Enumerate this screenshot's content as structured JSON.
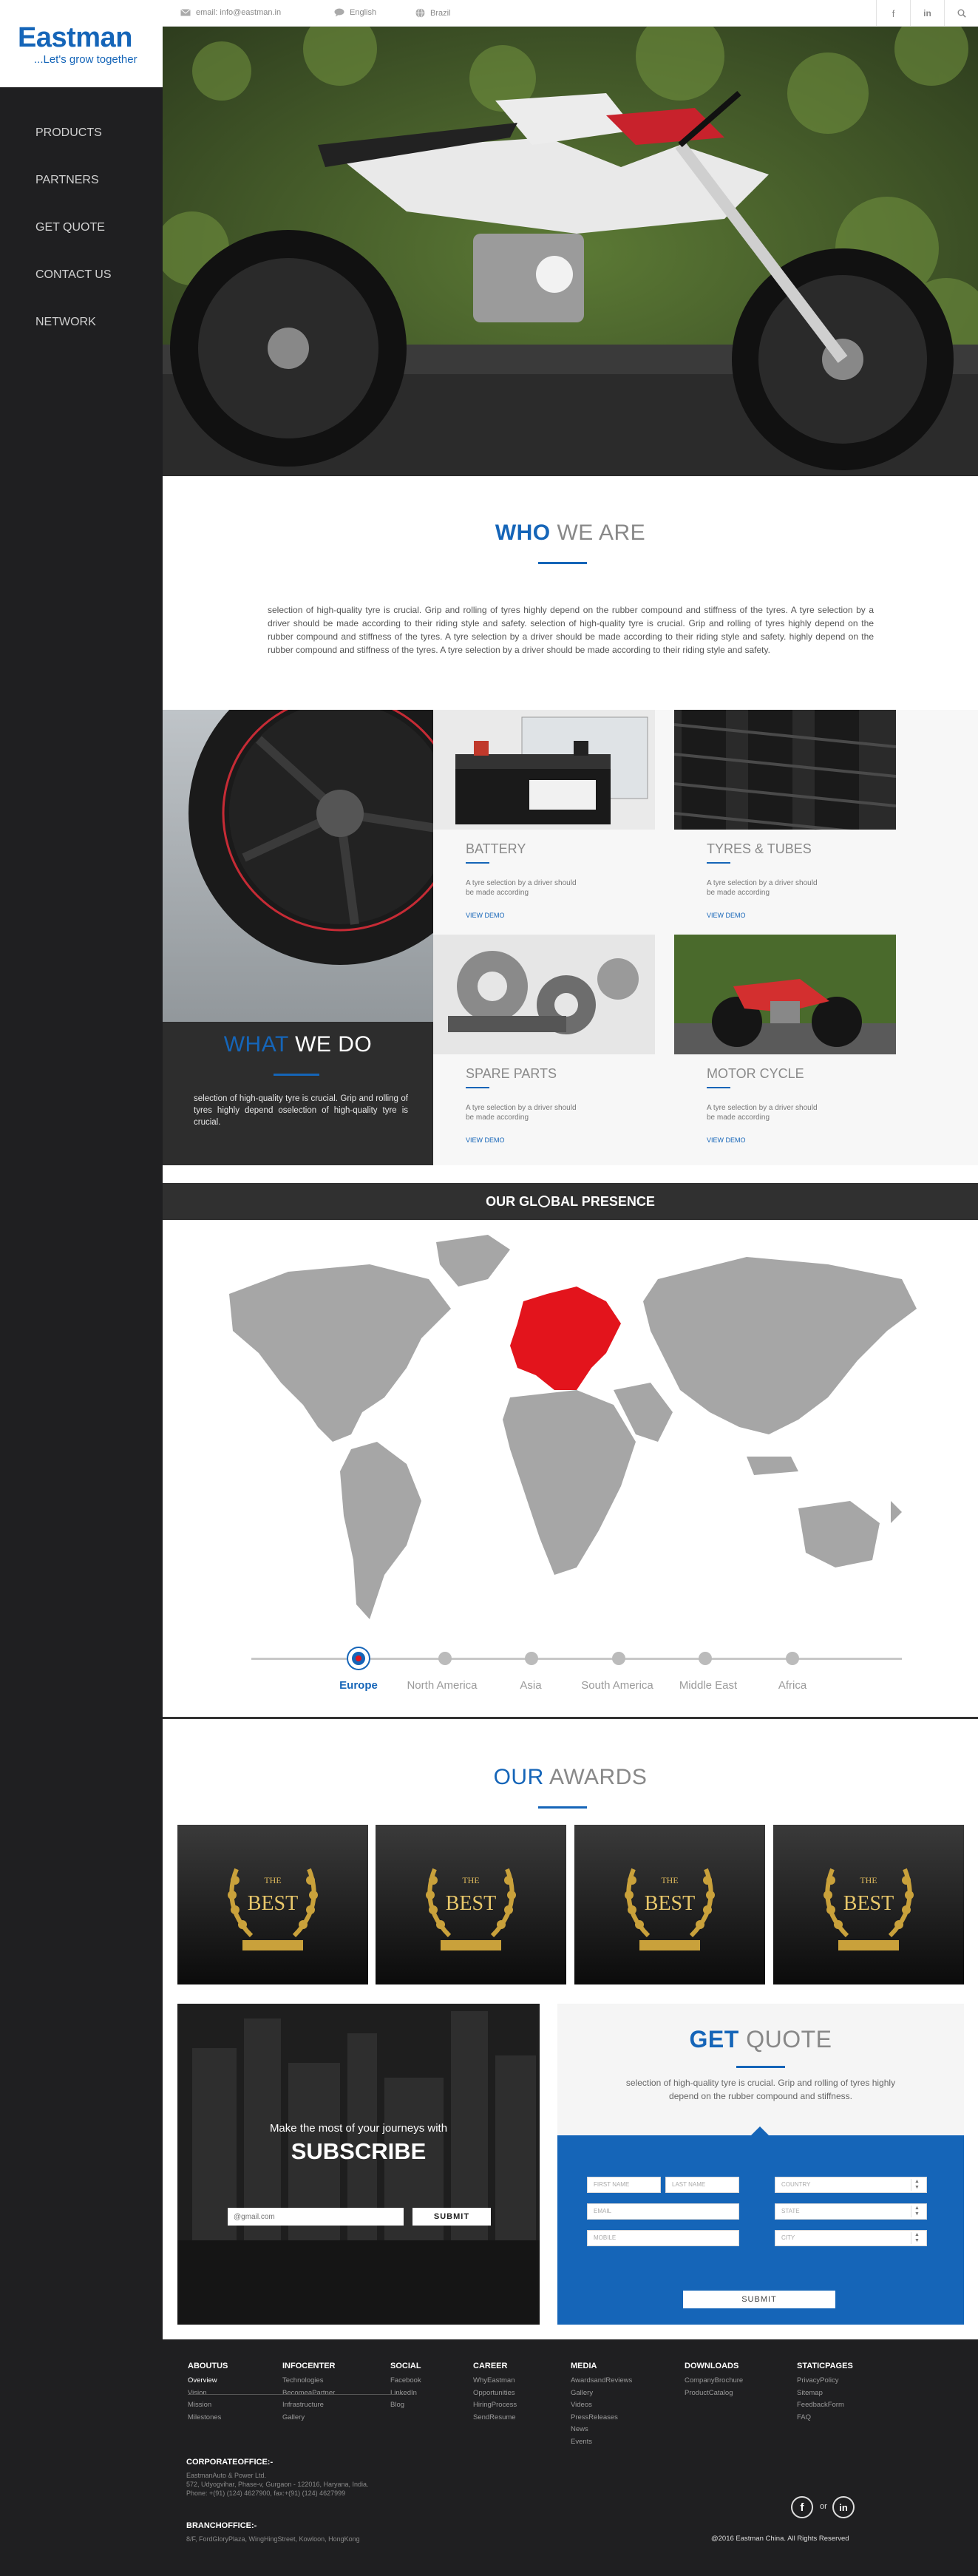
{
  "brand": {
    "name": "Eastman",
    "tagline": "...Let's grow together"
  },
  "nav": [
    "PRODUCTS",
    "PARTNERS",
    "GET QUOTE",
    "CONTACT US",
    "NETWORK"
  ],
  "topbar": {
    "email": "email: info@eastman.in",
    "language": "English",
    "country": "Brazil"
  },
  "who": {
    "title_a": "WHO",
    "title_b": "WE ARE",
    "text": "selection of high-quality tyre is crucial. Grip and rolling of tyres highly depend on the rubber compound and stiffness of the tyres. A tyre selection by a driver should be made according to their riding style and safety. selection of high-quality tyre is crucial. Grip and rolling of tyres highly depend on the rubber compound and stiffness of the tyres. A tyre selection by a driver should be made according to their riding style and safety. highly depend on the rubber compound and stiffness of the tyres. A tyre selection by a driver should be made according to their riding style and safety."
  },
  "whatdo": {
    "title_a": "WHAT",
    "title_b": "WE DO",
    "text": "selection of high-quality tyre is crucial. Grip and rolling of tyres highly depend oselection of high-quality tyre is crucial."
  },
  "products": [
    {
      "title": "BATTERY",
      "desc": "A tyre selection by a driver should be made according",
      "link": "VIEW DEMO"
    },
    {
      "title": "TYRES & TUBES",
      "desc": "A tyre selection by a driver should be made according",
      "link": "VIEW DEMO"
    },
    {
      "title": "SPARE PARTS",
      "desc": "A tyre selection by a driver should be made according",
      "link": "VIEW DEMO"
    },
    {
      "title": "MOTOR CYCLE",
      "desc": "A tyre selection by a driver should be made according",
      "link": "VIEW DEMO"
    }
  ],
  "global": {
    "title_a": "OUR GL",
    "title_b": "BAL PRESENCE",
    "regions": [
      "Europe",
      "North America",
      "Asia",
      "South America",
      "Middle East",
      "Africa"
    ],
    "active": "Europe"
  },
  "awards": {
    "title_a": "OUR",
    "title_b": "AWARDS",
    "badge_top": "THE",
    "badge": "BEST"
  },
  "subscribe": {
    "line": "Make the most of your journeys with",
    "title": "SUBSCRIBE",
    "placeholder": "@gmail.com",
    "button": "SUBMIT"
  },
  "quote": {
    "title_a": "GET",
    "title_b": "QUOTE",
    "text": "selection of high-quality tyre is crucial. Grip and rolling of tyres highly depend on the rubber compound and stiffness.",
    "fields": [
      "FIRST NAME",
      "LAST NAME",
      "EMAIL",
      "MOBILE",
      "COUNTRY",
      "STATE",
      "CITY"
    ],
    "button": "SUBMIT"
  },
  "footer": {
    "columns": [
      {
        "h": "ABOUTUS",
        "items": [
          "Overview",
          "Vision",
          "Mission",
          "Milestones"
        ]
      },
      {
        "h": "INFOCENTER",
        "items": [
          "Technologies",
          "BecomeaPartner",
          "Infrastructure",
          "Gallery"
        ]
      },
      {
        "h": "SOCIAL",
        "items": [
          "Facebook",
          "LinkedIn",
          "Blog"
        ]
      },
      {
        "h": "CAREER",
        "items": [
          "WhyEastman",
          "Opportunities",
          "HiringProcess",
          "SendResume"
        ]
      },
      {
        "h": "MEDIA",
        "items": [
          "AwardsandReviews",
          "Gallery",
          "Videos",
          "PressReleases",
          "News",
          "Events"
        ]
      },
      {
        "h": "DOWNLOADS",
        "items": [
          "CompanyBrochure",
          "ProductCatalog"
        ]
      },
      {
        "h": "STATICPAGES",
        "items": [
          "PrivacyPolicy",
          "Sitemap",
          "FeedbackForm",
          "FAQ"
        ]
      }
    ],
    "corporate_h": "CORPORATEOFFICE:-",
    "corporate_lines": [
      "EastmanAuto & Power Ltd.",
      "572, Udyogvihar, Phase-v, Gurgaon - 122016, Haryana, India.",
      "Phone: +(91) (124) 4627900, fax:+(91) (124) 4627999"
    ],
    "branch_h": "BRANCHOFFICE:-",
    "branch_lines": [
      "8/F, FordGloryPlaza, WingHingStreet, Kowloon, HongKong"
    ],
    "or": "or",
    "copyright": "@2016 Eastman China. All Rights Reserved"
  }
}
